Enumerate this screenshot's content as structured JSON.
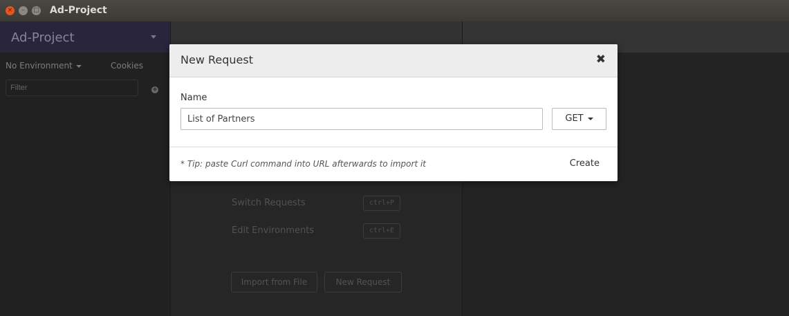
{
  "window": {
    "title": "Ad-Project"
  },
  "sidebar": {
    "workspace_name": "Ad-Project",
    "environment": "No Environment",
    "cookies": "Cookies",
    "filter_placeholder": "Filter"
  },
  "main": {
    "shortcuts": [
      {
        "label": "Switch Requests",
        "key": "ctrl+P"
      },
      {
        "label": "Edit Environments",
        "key": "ctrl+E"
      }
    ],
    "import_label": "Import from File",
    "new_request_label": "New Request"
  },
  "modal": {
    "title": "New Request",
    "close_glyph": "✖",
    "name_label": "Name",
    "name_value": "List of Partners",
    "method": "GET",
    "tip": "* Tip: paste Curl command into URL afterwards to import it",
    "create_label": "Create"
  }
}
